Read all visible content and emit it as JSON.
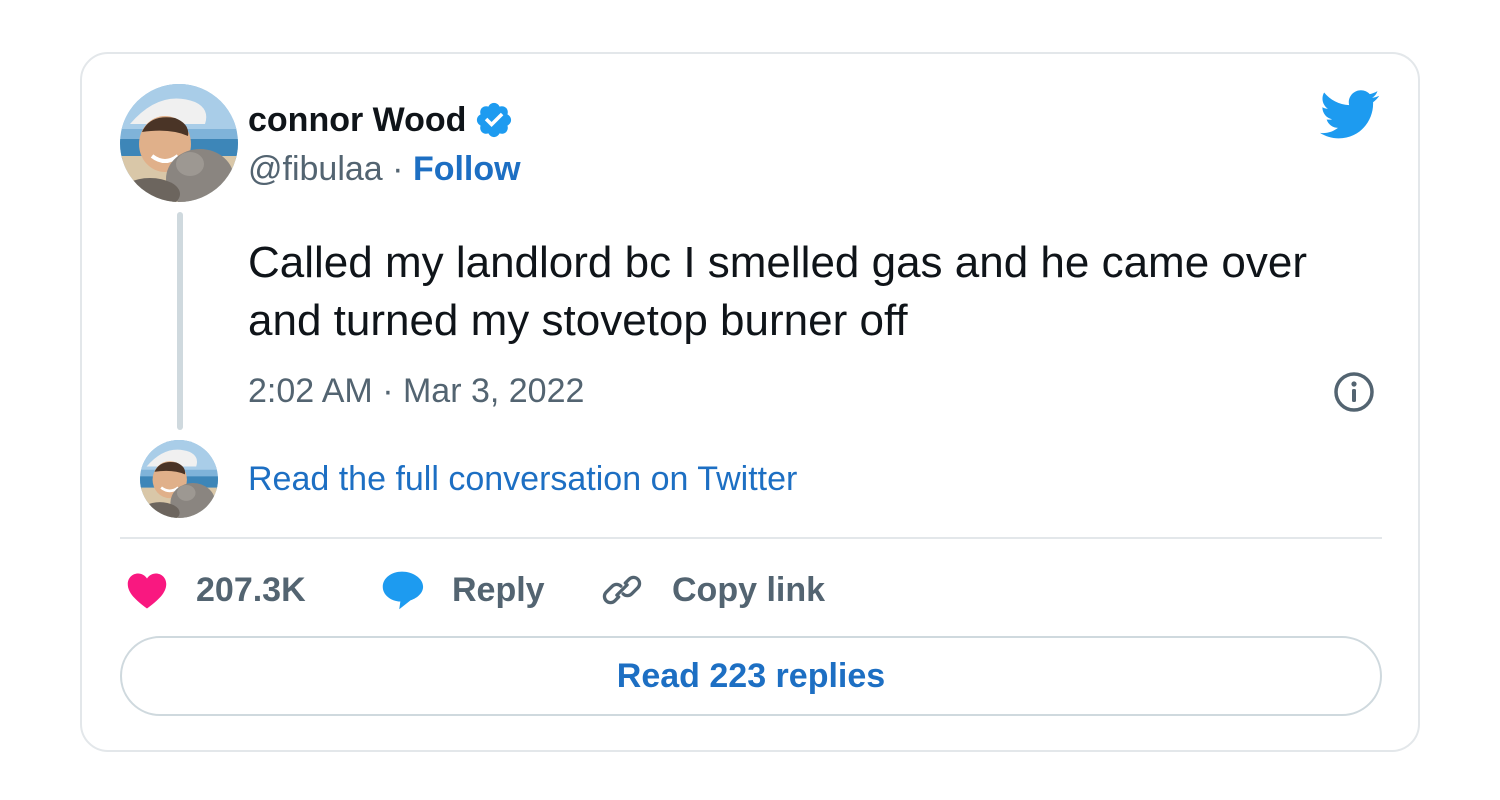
{
  "tweet": {
    "author_name": "connor Wood",
    "handle": "@fibulaa",
    "separator": " · ",
    "follow_label": "Follow",
    "text": "Called my landlord bc I smelled gas and he came over and turned my stovetop burner off",
    "timestamp": "2:02 AM · Mar 3, 2022",
    "read_conversation_label": "Read the full conversation on Twitter",
    "likes_count": "207.3K",
    "reply_label": "Reply",
    "copy_link_label": "Copy link",
    "read_replies_label": "Read 223 replies"
  },
  "icons": {
    "verified": "verified-badge-icon",
    "bird": "twitter-bird-icon",
    "info": "info-icon",
    "like": "heart-icon",
    "reply": "speech-bubble-icon",
    "copy_link": "link-icon"
  },
  "colors": {
    "text_primary": "#0f1419",
    "text_secondary": "#536471",
    "link_blue": "#1d6fc3",
    "twitter_blue": "#1d9bf0",
    "like_pink": "#f91880",
    "border": "#e3e7ea"
  }
}
